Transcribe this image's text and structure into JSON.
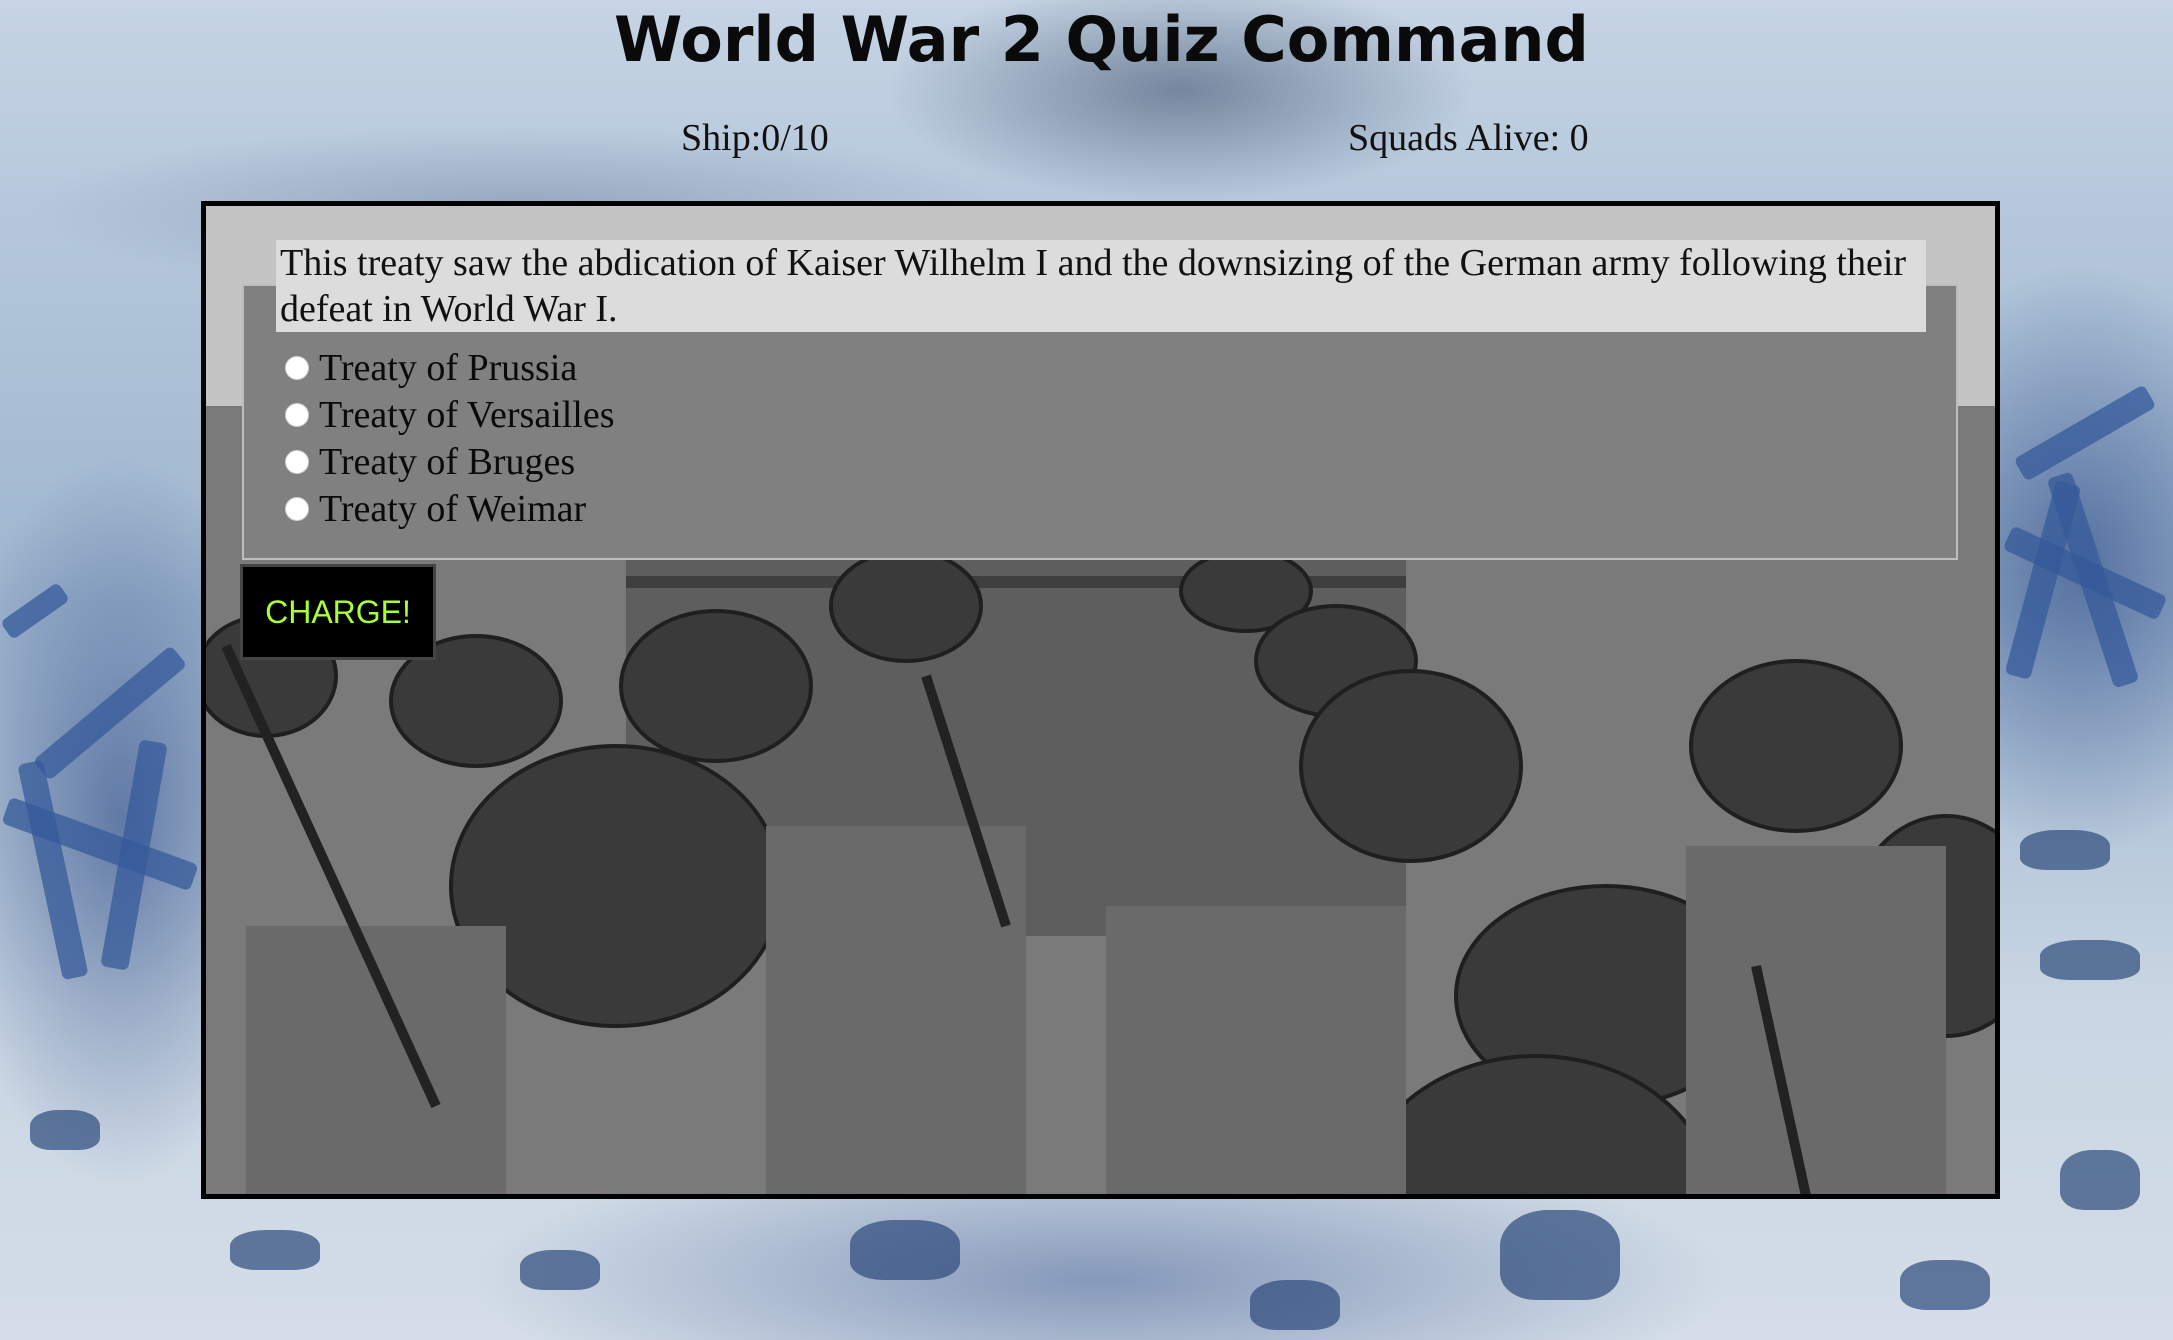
{
  "app": {
    "title": "World War 2 Quiz Command"
  },
  "stats": {
    "ship": "Ship:0/10",
    "squads": "Squads Alive: 0"
  },
  "quiz": {
    "question": "This treaty saw the abdication of Kaiser Wilhelm I and the downsizing of the German army following their defeat in World War I.",
    "options": [
      "Treaty of Prussia",
      "Treaty of Versailles",
      "Treaty of Bruges",
      "Treaty of Weimar"
    ],
    "submit_label": "CHARGE!"
  },
  "colors": {
    "button_text": "#a9ff39",
    "button_bg": "#000000",
    "panel_bg": "#808080",
    "question_bg": "#dcdcdc"
  }
}
